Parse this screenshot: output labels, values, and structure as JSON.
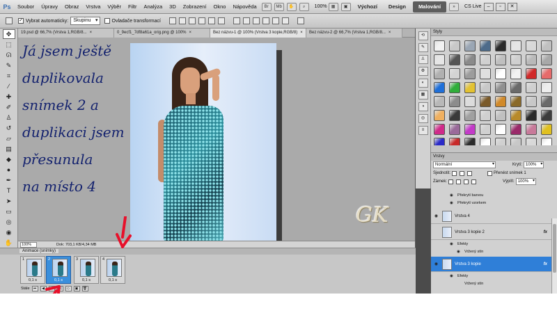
{
  "menubar": {
    "logo": "Ps",
    "items": [
      "Soubor",
      "Úpravy",
      "Obraz",
      "Vrstva",
      "Výběr",
      "Filtr",
      "Analýza",
      "3D",
      "Zobrazení",
      "Okno",
      "Nápověda"
    ],
    "zoom": "100%",
    "workspaces": [
      "Výchozí",
      "Design",
      "Malování"
    ],
    "active_workspace": "Malování",
    "cslive": "CS Live"
  },
  "optbar": {
    "auto_select_label": "Vybrat automaticky:",
    "auto_select_value": "Skupinu",
    "transform_label": "Ovladače transformací"
  },
  "tabs": [
    {
      "label": "19.psd @ 66,7% (Vrstva 1,RGB/8...",
      "active": false
    },
    {
      "label": "0_9ecf1_7df8a61a_orig.png @ 100%",
      "active": false
    },
    {
      "label": "Bez názvu-1 @ 100% (Vrstva 3 kopie,RGB/8)",
      "active": true
    },
    {
      "label": "Bez názvu-2 @ 66,7% (Vrstva 1,RGB/8...",
      "active": false
    }
  ],
  "canvas": {
    "overlay_lines": [
      "Já jsem ještě",
      "duplikovala",
      "snímek 2 a",
      "duplikaci jsem",
      "přesunula",
      "na místo 4"
    ],
    "watermark": "GK"
  },
  "statusbar": {
    "zoom": "100%",
    "doc_info": "Dok: 703,1 KB/4,34 MB"
  },
  "animation": {
    "panel_title": "Animace (snímky)",
    "frames": [
      {
        "num": "1",
        "delay": "0,1 s",
        "selected": false
      },
      {
        "num": "2",
        "delay": "0,1 s",
        "selected": true
      },
      {
        "num": "3",
        "delay": "0,1 s",
        "selected": false
      },
      {
        "num": "4",
        "delay": "0,1 s",
        "selected": false
      }
    ],
    "loop_label": "Stále"
  },
  "styles_panel": {
    "title": "Styly",
    "swatch_colors": [
      "#f2f2f2",
      "#c8c8c8",
      "#9aa6b4",
      "#4d6b8a",
      "#2a2a2a",
      "#e6e6e6",
      "#d8d8d8",
      "#c0c0c0",
      "#e6e6e6",
      "#555555",
      "#8a8a8a",
      "#d0d0d0",
      "#bfbfbf",
      "#cfcfcf",
      "#b9b9b9",
      "#a8a8a8",
      "#b0b0b0",
      "#d4d4d4",
      "#9c9c9c",
      "#e0e0e0",
      "#ffffff",
      "#f2f2f2",
      "#d12a2a",
      "#e66a6a",
      "#1e6fd9",
      "#2fae3a",
      "#e3c232",
      "#c8c8c8",
      "#909090",
      "#6a6a6a",
      "#cfcfcf",
      "#ededed",
      "#b8b8b8",
      "#8c8c8c",
      "#dcdcdc",
      "#7a5a2a",
      "#d18a2a",
      "#8a6a2a",
      "#c8c8c8",
      "#6a6a6a",
      "#f0b060",
      "#3a3a3a",
      "#a0a0a0",
      "#d0d0d0",
      "#c0c0c0",
      "#b88a2a",
      "#2a2a2a",
      "#3c3c3c",
      "#d02a8a",
      "#9a6a9a",
      "#c33ac8",
      "#d0d0d0",
      "#ffffff",
      "#9a2a6a",
      "#c87a9a",
      "#e0c020",
      "#2a2ac8",
      "#c82a2a",
      "#2a2a2a",
      "#ffffff",
      "#d0d0d0",
      "#c8c8c8",
      "#d8d8d8",
      "#ffffff"
    ]
  },
  "layers_panel": {
    "title": "Vrstvy",
    "blend_mode": "Normální",
    "opacity_label": "Krytí:",
    "opacity_value": "100%",
    "unify_label": "Sjednotit:",
    "propagate_label": "Přenést snímek 1",
    "lock_label": "Zámek:",
    "fill_label": "Výplň:",
    "fill_value": "100%",
    "rows": [
      {
        "kind": "sub",
        "label": "Překrytí barvou"
      },
      {
        "kind": "sub",
        "label": "Překrytí vzorkem"
      },
      {
        "kind": "layer",
        "name": "Vrstva 4",
        "fx": "",
        "selected": false
      },
      {
        "kind": "layer",
        "name": "Vrstva 3 kopie 2",
        "fx": "fx",
        "selected": false
      },
      {
        "kind": "sub",
        "label": "Efekty"
      },
      {
        "kind": "subdeep",
        "label": "Vržený stín"
      },
      {
        "kind": "layer",
        "name": "Vrstva 3 kopie",
        "fx": "fx",
        "selected": true
      },
      {
        "kind": "sub",
        "label": "Efekty"
      },
      {
        "kind": "subdeep",
        "label": "Vržený stín"
      }
    ]
  }
}
